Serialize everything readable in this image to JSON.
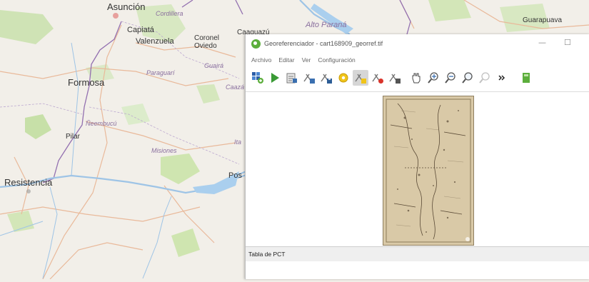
{
  "map_labels": {
    "asuncion": "Asunción",
    "cordillera": "Cordillera",
    "capiata": "Capiatá",
    "valenzuela": "Valenzuela",
    "coronel_oviedo": "Coronel\nOviedo",
    "caaguazu": "Caaguazú",
    "alto_parana": "Alto Paraná",
    "guarapuava": "Guarapuava",
    "formosa": "Formosa",
    "paraguari": "Paraguarí",
    "guaira": "Guairá",
    "caazapa": "Caazá",
    "neembucu": "Ñeembucú",
    "pilar": "Pilar",
    "misiones": "Misiones",
    "ita": "Ita",
    "resistencia": "Resistencia",
    "posadas": "Pos"
  },
  "window": {
    "title": "Georeferenciador - cart168909_georref.tif",
    "minimize": "—",
    "maximize": "☐",
    "menu": [
      "Archivo",
      "Editar",
      "Ver",
      "Configuración"
    ],
    "toolbar_icons": [
      "open-raster-icon",
      "start-georeferencing-icon",
      "generate-gdal-script-icon",
      "load-gcp-points-icon",
      "save-gcp-points-icon",
      "transformation-settings-icon",
      "add-point-icon",
      "delete-point-icon",
      "move-gcp-point-icon",
      "pan-icon",
      "zoom-in-icon",
      "zoom-out-icon",
      "zoom-to-layer-icon",
      "zoom-last-icon",
      "more-tools-icon",
      "link-georeferencer-icon"
    ],
    "pct_panel_title": "Tabla de PCT"
  },
  "colors": {
    "accent_green": "#5cae3c",
    "river_blue": "#9ec4e6",
    "border_purple": "#9370b0",
    "map_bg": "#f2efe9"
  }
}
